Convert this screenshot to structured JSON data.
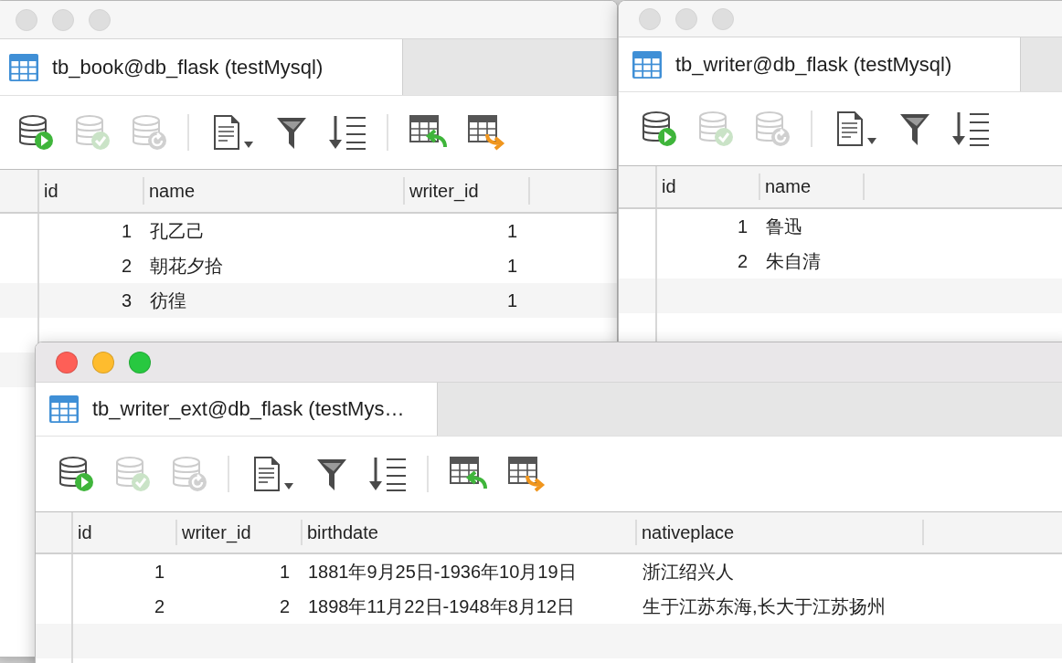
{
  "windows": [
    {
      "active": false,
      "tab": {
        "title": "tb_book@db_flask (testMysql)",
        "selected": true
      },
      "toolbar_groups": [
        [
          {
            "kind": "run",
            "disabled": false
          },
          {
            "kind": "commit",
            "disabled": true
          },
          {
            "kind": "refresh",
            "disabled": true
          }
        ],
        [
          {
            "kind": "document",
            "disabled": false
          },
          {
            "kind": "filter",
            "disabled": false
          },
          {
            "kind": "sort",
            "disabled": false
          }
        ],
        [
          {
            "kind": "import",
            "disabled": false
          },
          {
            "kind": "export",
            "disabled": false
          }
        ]
      ],
      "columns": [
        {
          "name": "id",
          "kind": "number"
        },
        {
          "name": "name",
          "kind": "text"
        },
        {
          "name": "writer_id",
          "kind": "number"
        }
      ],
      "rows": [
        [
          "1",
          "孔乙己",
          "1"
        ],
        [
          "2",
          "朝花夕拾",
          "1"
        ],
        [
          "3",
          "彷徨",
          "1"
        ]
      ]
    },
    {
      "active": false,
      "tab": {
        "title": "tb_writer@db_flask (testMysql)",
        "selected": true
      },
      "toolbar_groups": [
        [
          {
            "kind": "run",
            "disabled": false
          },
          {
            "kind": "commit",
            "disabled": true
          },
          {
            "kind": "refresh",
            "disabled": true
          }
        ],
        [
          {
            "kind": "document",
            "disabled": false
          },
          {
            "kind": "filter",
            "disabled": false
          },
          {
            "kind": "sort",
            "disabled": false
          }
        ]
      ],
      "columns": [
        {
          "name": "id",
          "kind": "number"
        },
        {
          "name": "name",
          "kind": "text"
        }
      ],
      "rows": [
        [
          "1",
          "鲁迅"
        ],
        [
          "2",
          "朱自清"
        ]
      ]
    },
    {
      "active": true,
      "tab": {
        "title": "tb_writer_ext@db_flask (testMys…",
        "selected": true
      },
      "toolbar_groups": [
        [
          {
            "kind": "run",
            "disabled": false
          },
          {
            "kind": "commit",
            "disabled": true
          },
          {
            "kind": "refresh",
            "disabled": true
          }
        ],
        [
          {
            "kind": "document",
            "disabled": false
          },
          {
            "kind": "filter",
            "disabled": false
          },
          {
            "kind": "sort",
            "disabled": false
          }
        ],
        [
          {
            "kind": "import",
            "disabled": false
          },
          {
            "kind": "export",
            "disabled": false
          }
        ]
      ],
      "columns": [
        {
          "name": "id",
          "kind": "number"
        },
        {
          "name": "writer_id",
          "kind": "number"
        },
        {
          "name": "birthdate",
          "kind": "text"
        },
        {
          "name": "nativeplace",
          "kind": "text"
        }
      ],
      "rows": [
        [
          "1",
          "1",
          "1881年9月25日-1936年10月19日",
          "浙江绍兴人"
        ],
        [
          "2",
          "2",
          "1898年11月22日-1948年8月12日",
          "生于江苏东海,长大于江苏扬州"
        ]
      ]
    }
  ]
}
